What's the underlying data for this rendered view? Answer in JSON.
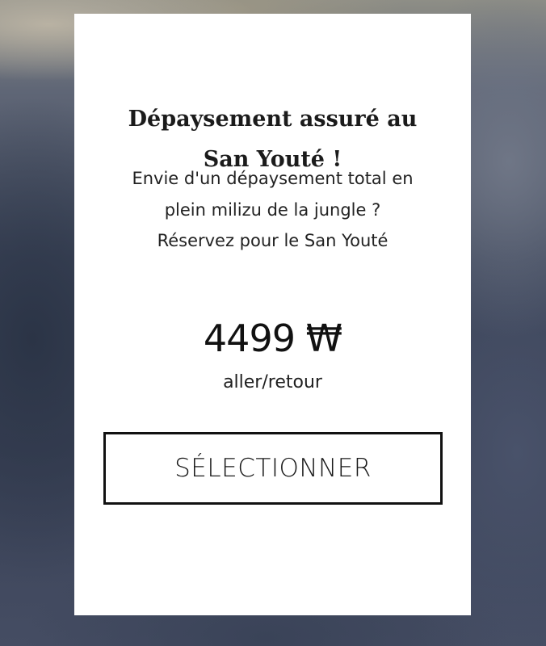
{
  "offer": {
    "title_line1": "Dépaysement assuré au",
    "title_line2": "San Youté !",
    "description_line1": "Envie d'un dépaysement total en",
    "description_line2": "plein milizu de la jungle ?",
    "description_line3": "Réservez pour le San Youté",
    "price": "4499 ₩",
    "price_note": "aller/retour",
    "select_label": "SÉLECTIONNER"
  },
  "colors": {
    "card_background": "#ffffff",
    "button_border": "#111111",
    "text": "#1b1b1b"
  }
}
